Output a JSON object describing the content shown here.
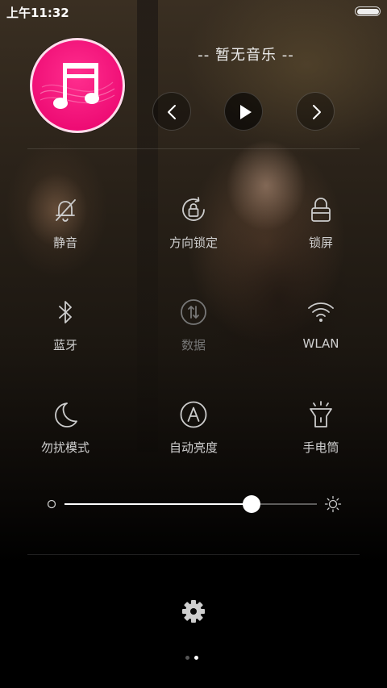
{
  "status_bar": {
    "time": "上午11:32"
  },
  "music": {
    "title": "-- 暂无音乐 --",
    "album_color": "#ff1a80"
  },
  "toggles": [
    {
      "label": "静音",
      "icon": "bell-off-icon",
      "enabled": true
    },
    {
      "label": "方向锁定",
      "icon": "rotation-lock-icon",
      "enabled": true
    },
    {
      "label": "锁屏",
      "icon": "lock-icon",
      "enabled": true
    },
    {
      "label": "蓝牙",
      "icon": "bluetooth-icon",
      "enabled": true
    },
    {
      "label": "数据",
      "icon": "mobile-data-icon",
      "enabled": false
    },
    {
      "label": "WLAN",
      "icon": "wifi-icon",
      "enabled": true
    },
    {
      "label": "勿扰模式",
      "icon": "moon-icon",
      "enabled": true
    },
    {
      "label": "自动亮度",
      "icon": "auto-brightness-icon",
      "enabled": true
    },
    {
      "label": "手电筒",
      "icon": "flashlight-icon",
      "enabled": true
    }
  ],
  "brightness": {
    "level": 0.74
  },
  "pager": {
    "count": 2,
    "active_index": 1
  },
  "colors": {
    "accent": "#ff1a80",
    "label": "#d0d0d0",
    "disabled": "#777777"
  }
}
